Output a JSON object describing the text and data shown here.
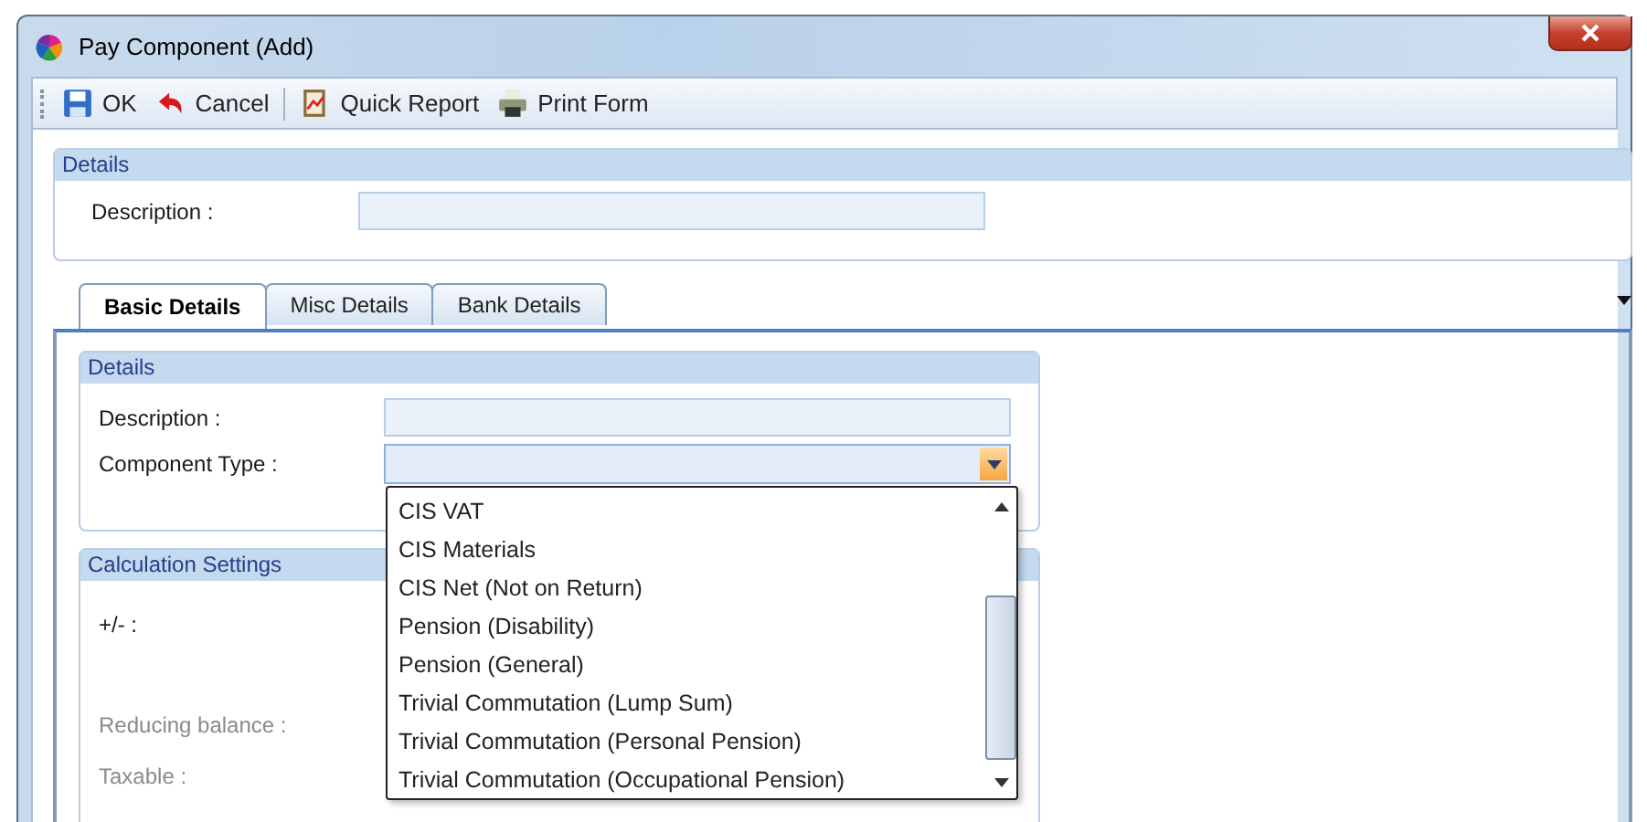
{
  "window": {
    "title": "Pay Component (Add)"
  },
  "toolbar": [
    {
      "kind": "save",
      "label": "OK"
    },
    {
      "kind": "cancel",
      "label": "Cancel"
    },
    {
      "kind": "report",
      "label": "Quick Report"
    },
    {
      "kind": "print",
      "label": "Print Form"
    }
  ],
  "details": {
    "title": "Details",
    "fields": [
      {
        "label": "Description :"
      }
    ]
  },
  "tabs": [
    {
      "label": "Basic Details",
      "selected": true
    },
    {
      "label": "Misc Details",
      "selected": false
    },
    {
      "label": "Bank Details",
      "selected": false
    }
  ],
  "basic_details": {
    "title": "Details",
    "fields": [
      {
        "label": "Description :",
        "kind": "text"
      },
      {
        "label": "Component Type :",
        "kind": "combo",
        "expanded": true
      }
    ]
  },
  "component_type_options": [
    "CIS VAT",
    "CIS Materials",
    "CIS Net (Not on Return)",
    "Pension (Disability)",
    "Pension (General)",
    "Trivial Commutation (Lump Sum)",
    "Trivial Commutation (Personal Pension)",
    "Trivial Commutation (Occupational Pension)"
  ],
  "calculation_settings": {
    "title": "Calculation Settings",
    "fields": [
      {
        "label": "+/- :",
        "disabled": false
      },
      {
        "label": "Reducing balance :",
        "disabled": true
      },
      {
        "label": "Taxable :",
        "disabled": true
      }
    ]
  }
}
